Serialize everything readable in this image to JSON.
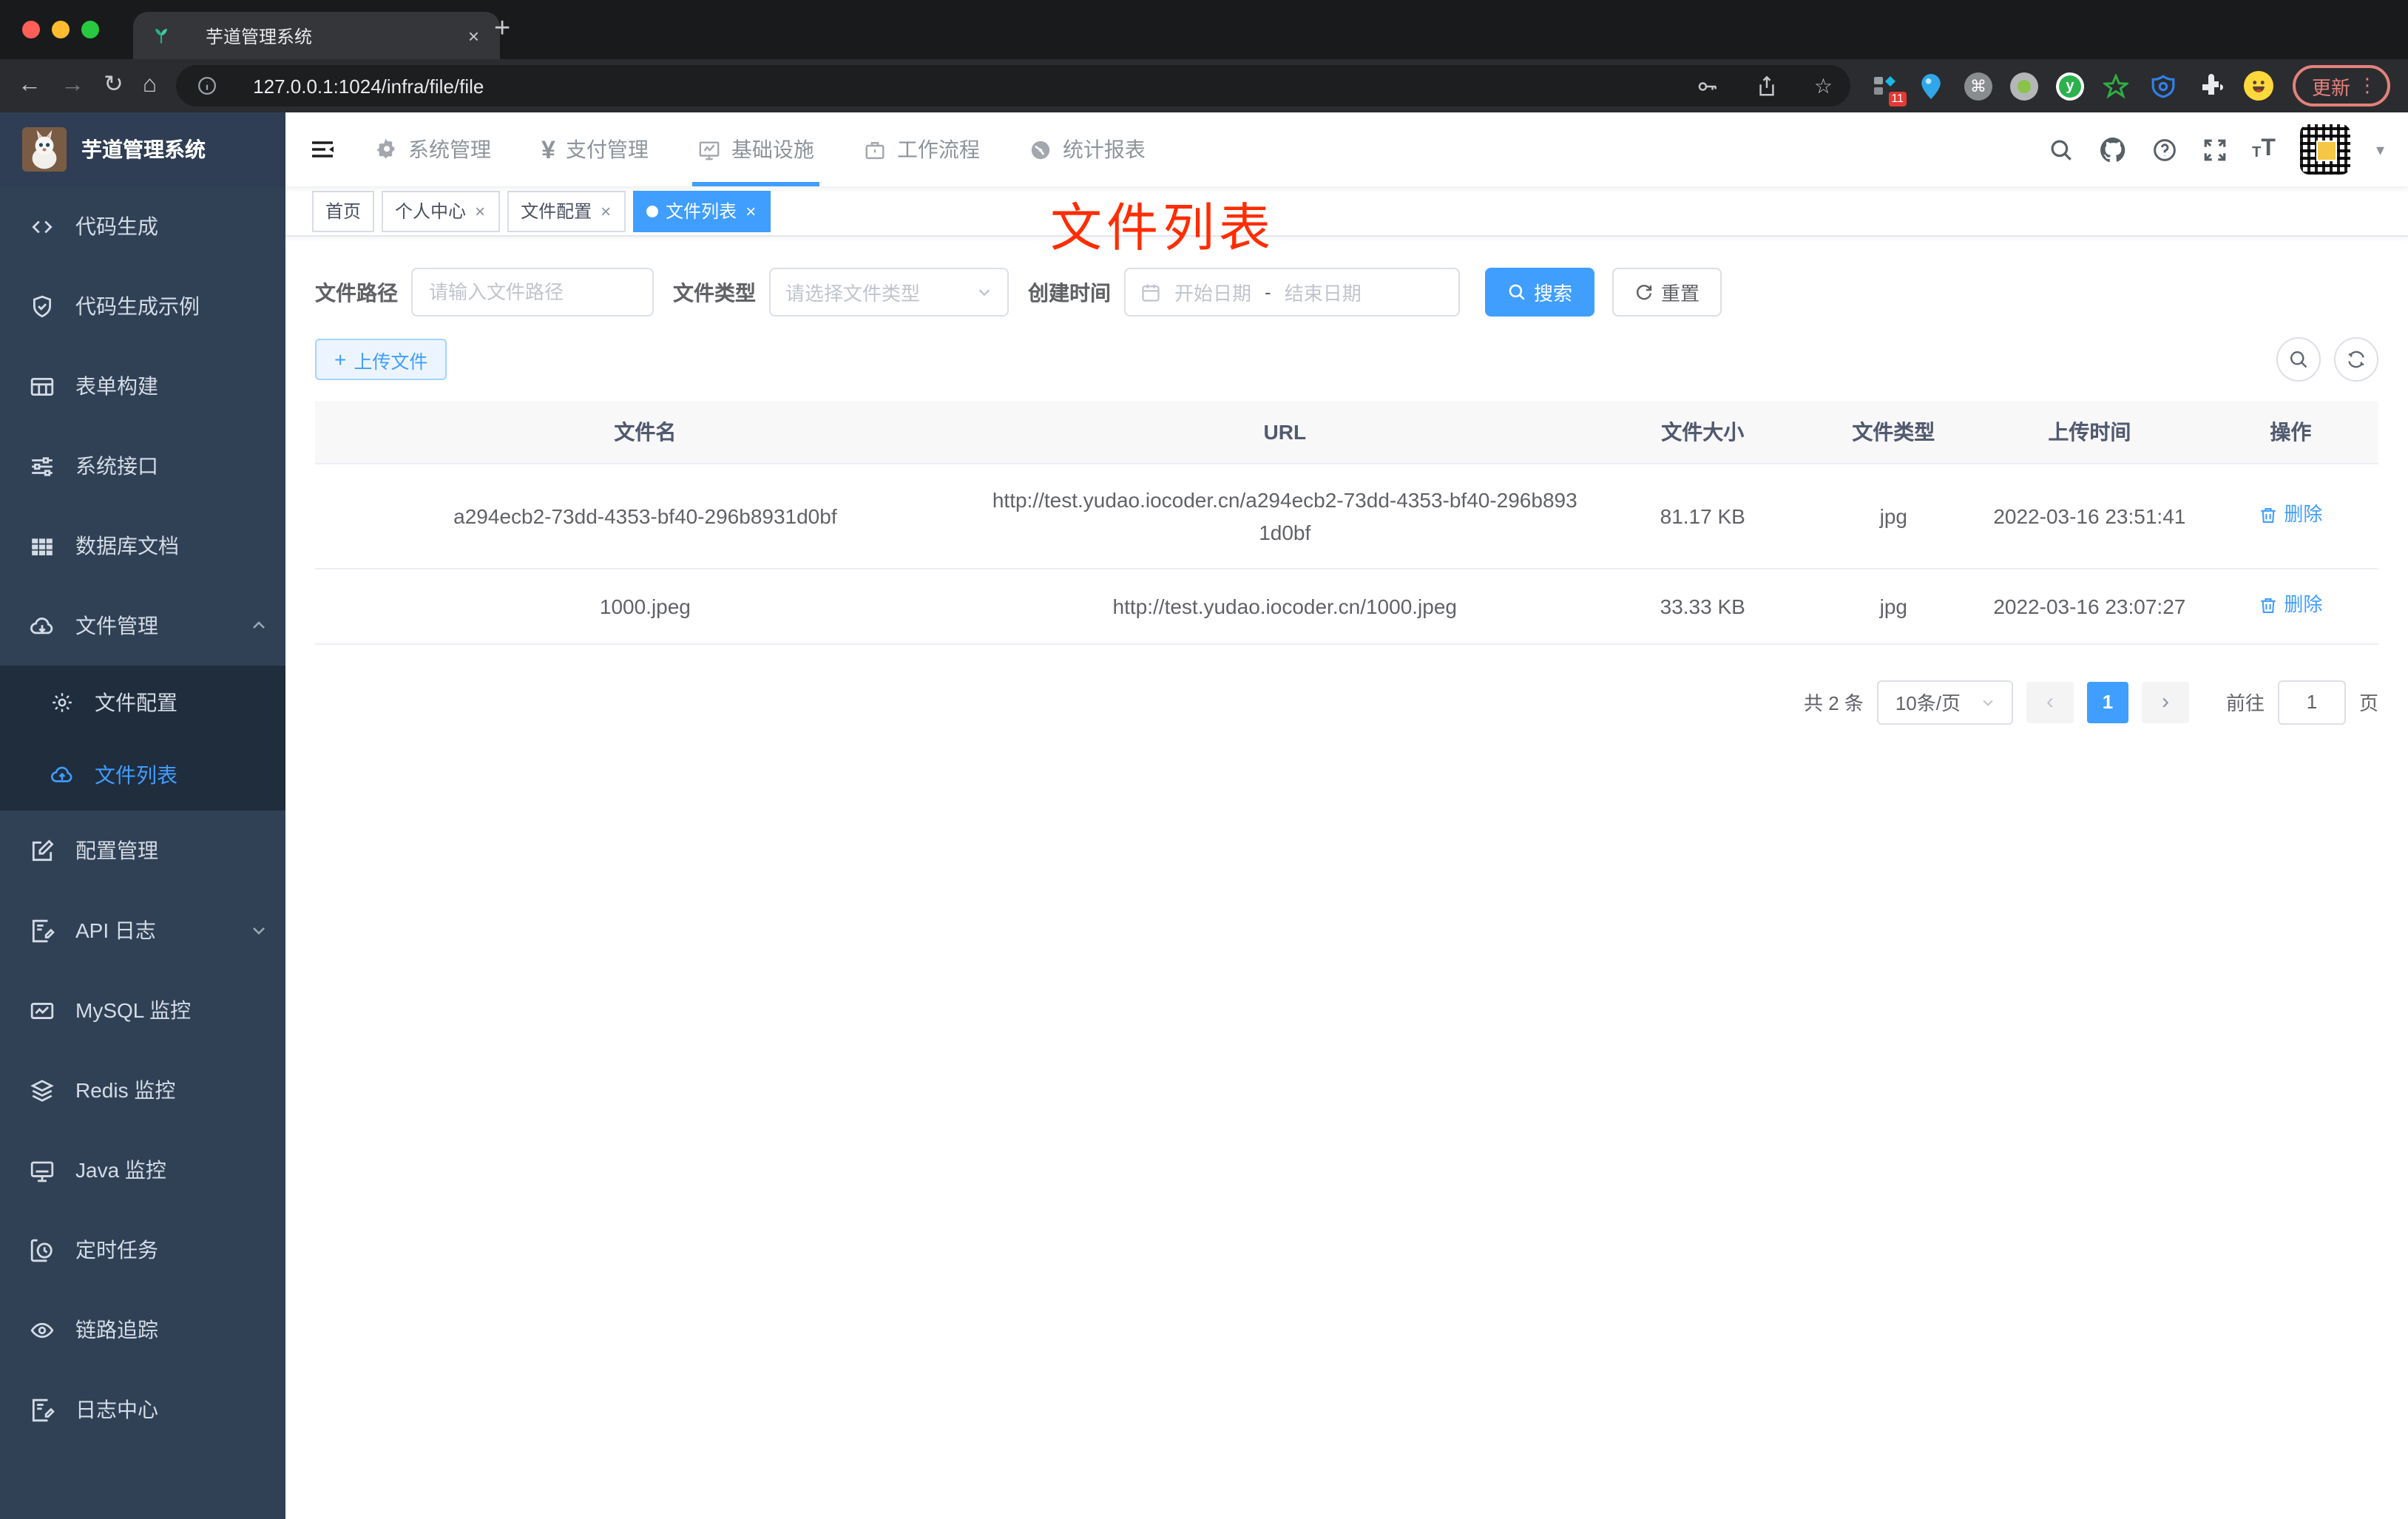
{
  "browser": {
    "tab": {
      "title": "芋道管理系统",
      "close_glyph": "×",
      "new_tab_glyph": "+",
      "favicon": "plant-icon"
    },
    "toolbar": {
      "url": "127.0.0.1:1024/infra/file/file",
      "back_glyph": "←",
      "forward_glyph": "→",
      "reload_glyph": "↻",
      "home_glyph": "⌂",
      "star_glyph": "☆",
      "update_label": "更新",
      "menu_glyph": "⋮",
      "extension_badge": "11",
      "cmd_glyph": "⌘",
      "y_glyph": "y"
    }
  },
  "app_header": {
    "menus": [
      {
        "label": "系统管理",
        "icon": "gear-icon"
      },
      {
        "label": "支付管理",
        "icon": "yen-icon",
        "glyph": "¥"
      },
      {
        "label": "基础设施",
        "icon": "monitor-icon",
        "active": true
      },
      {
        "label": "工作流程",
        "icon": "briefcase-icon"
      },
      {
        "label": "统计报表",
        "icon": "dashboard-icon"
      }
    ],
    "font_small_glyph": "T",
    "font_big_glyph": "T",
    "caret_glyph": "▾"
  },
  "sidebar": {
    "title": "芋道管理系统",
    "items": [
      {
        "label": "代码生成",
        "icon": "code-icon"
      },
      {
        "label": "代码生成示例",
        "icon": "shield-check-icon"
      },
      {
        "label": "表单构建",
        "icon": "form-grid-icon"
      },
      {
        "label": "系统接口",
        "icon": "sliders-icon"
      },
      {
        "label": "数据库文档",
        "icon": "table-icon"
      },
      {
        "label": "文件管理",
        "icon": "cloud-download-icon",
        "expanded": true,
        "children": [
          {
            "label": "文件配置",
            "icon": "gear-icon"
          },
          {
            "label": "文件列表",
            "icon": "cloud-upload-icon",
            "active": true
          }
        ]
      },
      {
        "label": "配置管理",
        "icon": "edit-icon"
      },
      {
        "label": "API 日志",
        "icon": "log-edit-icon",
        "has_children": true
      },
      {
        "label": "MySQL 监控",
        "icon": "chart-monitor-icon"
      },
      {
        "label": "Redis 监控",
        "icon": "layers-icon"
      },
      {
        "label": "Java 监控",
        "icon": "screen-icon"
      },
      {
        "label": "定时任务",
        "icon": "timer-icon"
      },
      {
        "label": "链路追踪",
        "icon": "eye-icon"
      },
      {
        "label": "日志中心",
        "icon": "log-edit-icon"
      }
    ]
  },
  "tags": {
    "close_glyph": "×",
    "items": [
      {
        "label": "首页"
      },
      {
        "label": "个人中心",
        "closable": true
      },
      {
        "label": "文件配置",
        "closable": true
      },
      {
        "label": "文件列表",
        "closable": true,
        "active": true
      }
    ]
  },
  "annotation": {
    "text": "文件列表",
    "color": "#ff2d00"
  },
  "filters": {
    "path": {
      "label": "文件路径",
      "placeholder": "请输入文件路径"
    },
    "type": {
      "label": "文件类型",
      "placeholder": "请选择文件类型"
    },
    "date": {
      "label": "创建时间",
      "start_placeholder": "开始日期",
      "separator": "-",
      "end_placeholder": "结束日期"
    },
    "search_label": "搜索",
    "reset_label": "重置"
  },
  "actions": {
    "upload_label": "上传文件",
    "plus_glyph": "+"
  },
  "table": {
    "headers": [
      "文件名",
      "URL",
      "文件大小",
      "文件类型",
      "上传时间",
      "操作"
    ],
    "rows": [
      {
        "name": "a294ecb2-73dd-4353-bf40-296b8931d0bf",
        "url": "http://test.yudao.iocoder.cn/a294ecb2-73dd-4353-bf40-296b8931d0bf",
        "size": "81.17 KB",
        "type": "jpg",
        "time": "2022-03-16 23:51:41",
        "action": "删除"
      },
      {
        "name": "1000.jpeg",
        "url": "http://test.yudao.iocoder.cn/1000.jpeg",
        "size": "33.33 KB",
        "type": "jpg",
        "time": "2022-03-16 23:07:27",
        "action": "删除"
      }
    ]
  },
  "pagination": {
    "total": "共 2 条",
    "per_page": "10条/页",
    "prev_glyph": "‹",
    "next_glyph": "›",
    "page": "1",
    "goto_label": "前往",
    "goto_value": "1",
    "goto_unit": "页"
  },
  "colors": {
    "accent": "#409eff",
    "annotation_red": "#ff2d00",
    "sidebar_bg": "#304156",
    "submenu_bg": "#1f2d3d",
    "tag_active_bg": "#409eff",
    "header_underline": "#409eff"
  }
}
